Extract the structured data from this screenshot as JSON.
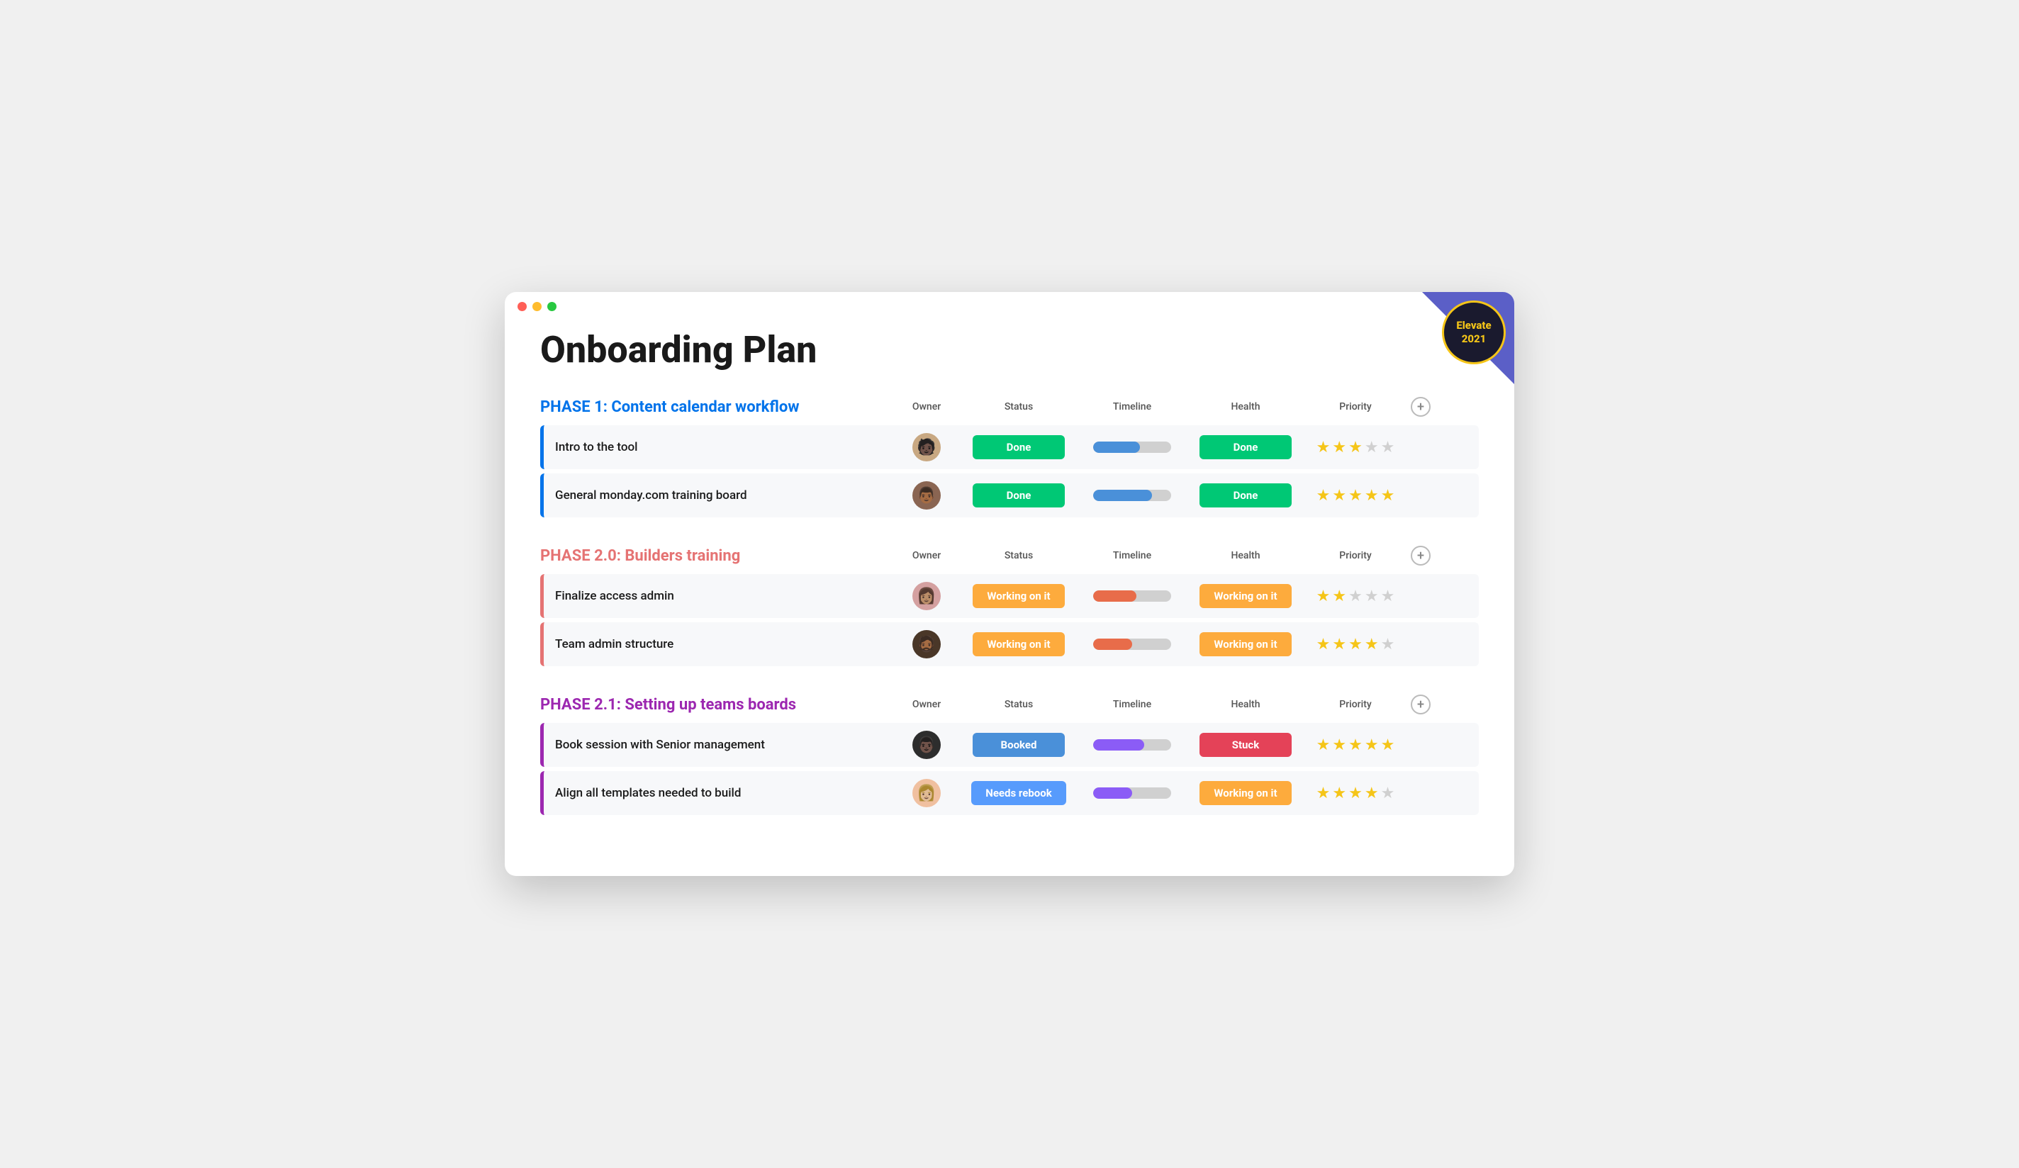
{
  "window": {
    "title": "Onboarding Plan"
  },
  "badge": {
    "line1": "Elevate",
    "line2": "2021"
  },
  "phases": [
    {
      "id": "phase1",
      "title": "PHASE 1: Content calendar workflow",
      "color": "blue",
      "tasks": [
        {
          "name": "Intro to the tool",
          "owner_label": "Person 1",
          "status": "Done",
          "status_type": "done",
          "timeline_type": "blue",
          "health": "Done",
          "health_type": "done",
          "stars": 3
        },
        {
          "name": "General monday.com training board",
          "owner_label": "Person 2",
          "status": "Done",
          "status_type": "done",
          "timeline_type": "blue-full",
          "health": "Done",
          "health_type": "done",
          "stars": 5
        }
      ]
    },
    {
      "id": "phase2",
      "title": "PHASE 2.0: Builders training",
      "color": "pink",
      "tasks": [
        {
          "name": "Finalize access admin",
          "owner_label": "Person 3",
          "status": "Working on it",
          "status_type": "working",
          "timeline_type": "orange",
          "health": "Working on it",
          "health_type": "working",
          "stars": 2
        },
        {
          "name": "Team admin structure",
          "owner_label": "Person 4",
          "status": "Working on it",
          "status_type": "working",
          "timeline_type": "orange2",
          "health": "Working on it",
          "health_type": "working",
          "stars": 4
        }
      ]
    },
    {
      "id": "phase21",
      "title": "PHASE 2.1: Setting up teams boards",
      "color": "purple",
      "tasks": [
        {
          "name": "Book session with Senior management",
          "owner_label": "Person 5",
          "status": "Booked",
          "status_type": "booked",
          "timeline_type": "purple",
          "health": "Stuck",
          "health_type": "stuck",
          "stars": 5
        },
        {
          "name": "Align all templates needed to build",
          "owner_label": "Person 6",
          "status": "Needs rebook",
          "status_type": "needs-rebook",
          "timeline_type": "purple2",
          "health": "Working on it",
          "health_type": "working",
          "stars": 4
        }
      ]
    }
  ],
  "columns": {
    "owner": "Owner",
    "status": "Status",
    "timeline": "Timeline",
    "health": "Health",
    "priority": "Priority"
  }
}
